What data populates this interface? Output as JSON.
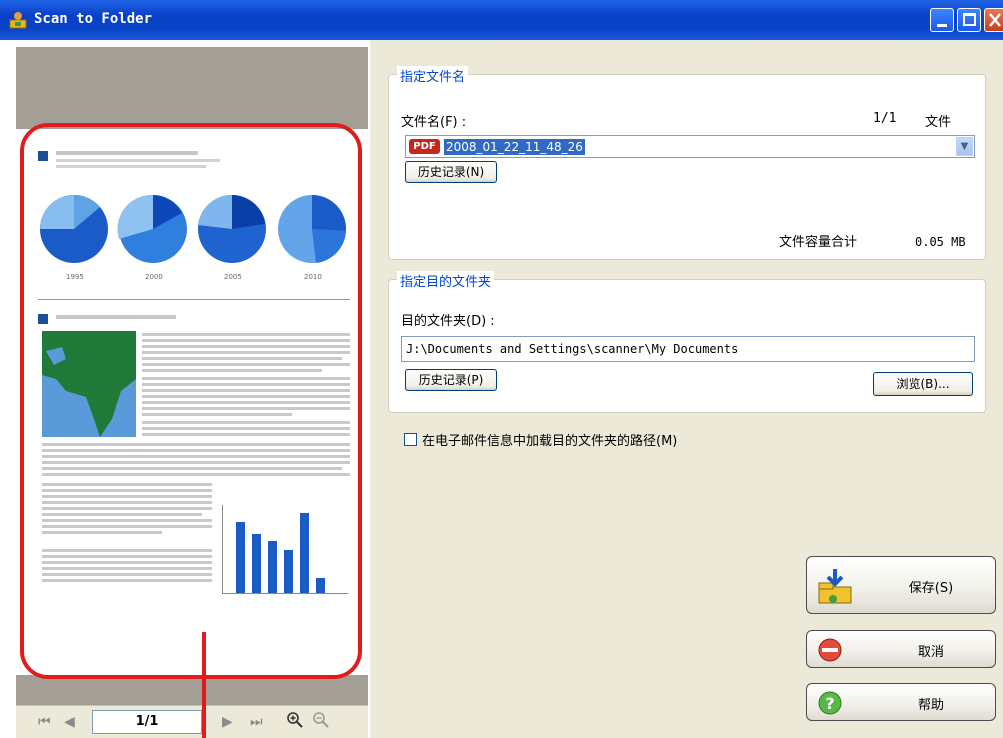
{
  "window": {
    "title": "Scan to Folder"
  },
  "preview": {
    "page_indicator": "1/1",
    "doc_years": [
      "1995",
      "2000",
      "2005",
      "2010"
    ]
  },
  "file_name_group": {
    "legend": "指定文件名",
    "file_name_label": "文件名(F) :",
    "count_value": "1/1",
    "count_unit": "文件",
    "file_name_value": "2008_01_22_11_48_26",
    "history_button": "历史记录(N)",
    "total_size_label": "文件容量合计",
    "total_size_value": "0.05 MB"
  },
  "destination_group": {
    "legend": "指定目的文件夹",
    "folder_label": "目的文件夹(D) :",
    "folder_path": "J:\\Documents and Settings\\scanner\\My Documents",
    "history_button": "历史记录(P)",
    "browse_button": "浏览(B)..."
  },
  "email_path_checkbox": {
    "label": "在电子邮件信息中加载目的文件夹的路径(M)",
    "checked": false
  },
  "actions": {
    "save": "保存(S)",
    "cancel": "取消",
    "help": "帮助"
  }
}
